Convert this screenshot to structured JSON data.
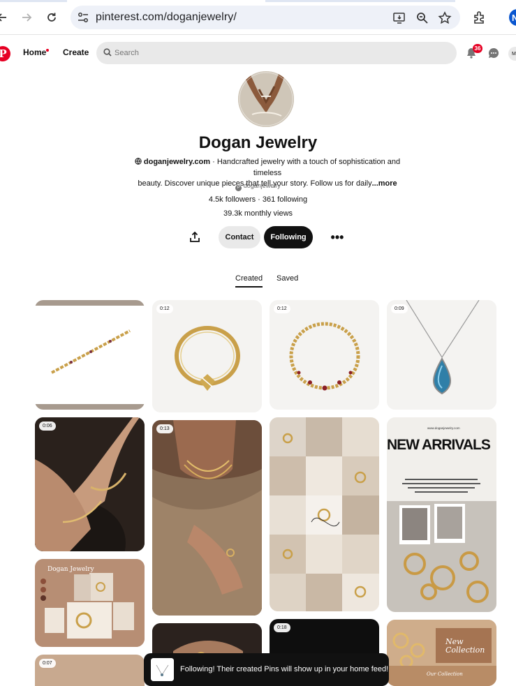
{
  "browser": {
    "url": "pinterest.com/doganjewelry/",
    "profile_initial": "N"
  },
  "header": {
    "logo": "P",
    "home_label": "Home",
    "create_label": "Create",
    "search_placeholder": "Search",
    "notification_count": "36",
    "avatar_initial": "M"
  },
  "profile": {
    "name": "Dogan Jewelry",
    "website": "doganjewelry.com",
    "bio_line1": "· Handcrafted jewelry with a touch of sophistication and timeless",
    "bio_line2": "beauty. Discover unique pieces that tell your story. Follow us for daily",
    "bio_more": "...more",
    "handle": "doganjewelry",
    "stats": "4.5k followers · 361 following",
    "monthly_views": "39.3k monthly views",
    "contact_label": "Contact",
    "following_label": "Following"
  },
  "tabs": {
    "created": "Created",
    "saved": "Saved"
  },
  "pins": {
    "durations": {
      "p2": "0:12",
      "p3": "0:12",
      "p4": "0:09",
      "p5": "0:06",
      "p6": "0:13",
      "p10": "0:18",
      "p11": "0:07"
    },
    "collage_header": "Dogan Jewelry",
    "new_arrivals_title": "NEW ARRIVALS",
    "new_arrivals_site": "www.doganjewelry.com",
    "new_collection": "New Collection",
    "our_collection": "Our Collection"
  },
  "toast": {
    "message": "Following! Their created Pins will show up in your home feed!"
  },
  "colors": {
    "pinterest_red": "#e60023",
    "button_dark": "#111111",
    "button_light": "#e9e9e9"
  }
}
